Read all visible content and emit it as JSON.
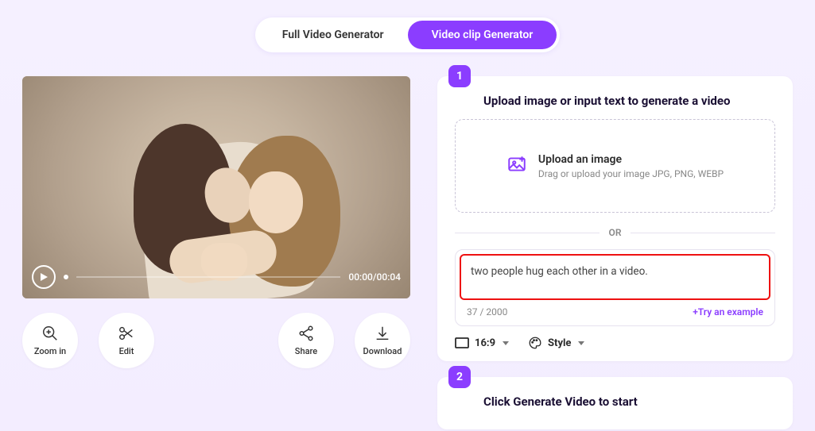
{
  "toggle": {
    "tabs": [
      "Full Video Generator",
      "Video clip Generator"
    ],
    "activeIndex": 1
  },
  "player": {
    "time_current": "00:00",
    "time_total": "00:04"
  },
  "actions": {
    "zoom": "Zoom in",
    "edit": "Edit",
    "share": "Share",
    "download": "Download"
  },
  "step1": {
    "badge": "1",
    "title": "Upload image or input text to generate a video",
    "upload_title": "Upload an image",
    "upload_sub": "Drag or upload your image JPG, PNG, WEBP",
    "or": "OR",
    "prompt_text": "two people hug each other in a video.",
    "counter": "37 / 2000",
    "try_example": "+Try an example",
    "aspect_label": "16:9",
    "style_label": "Style"
  },
  "step2": {
    "badge": "2",
    "title": "Click Generate Video to start"
  }
}
